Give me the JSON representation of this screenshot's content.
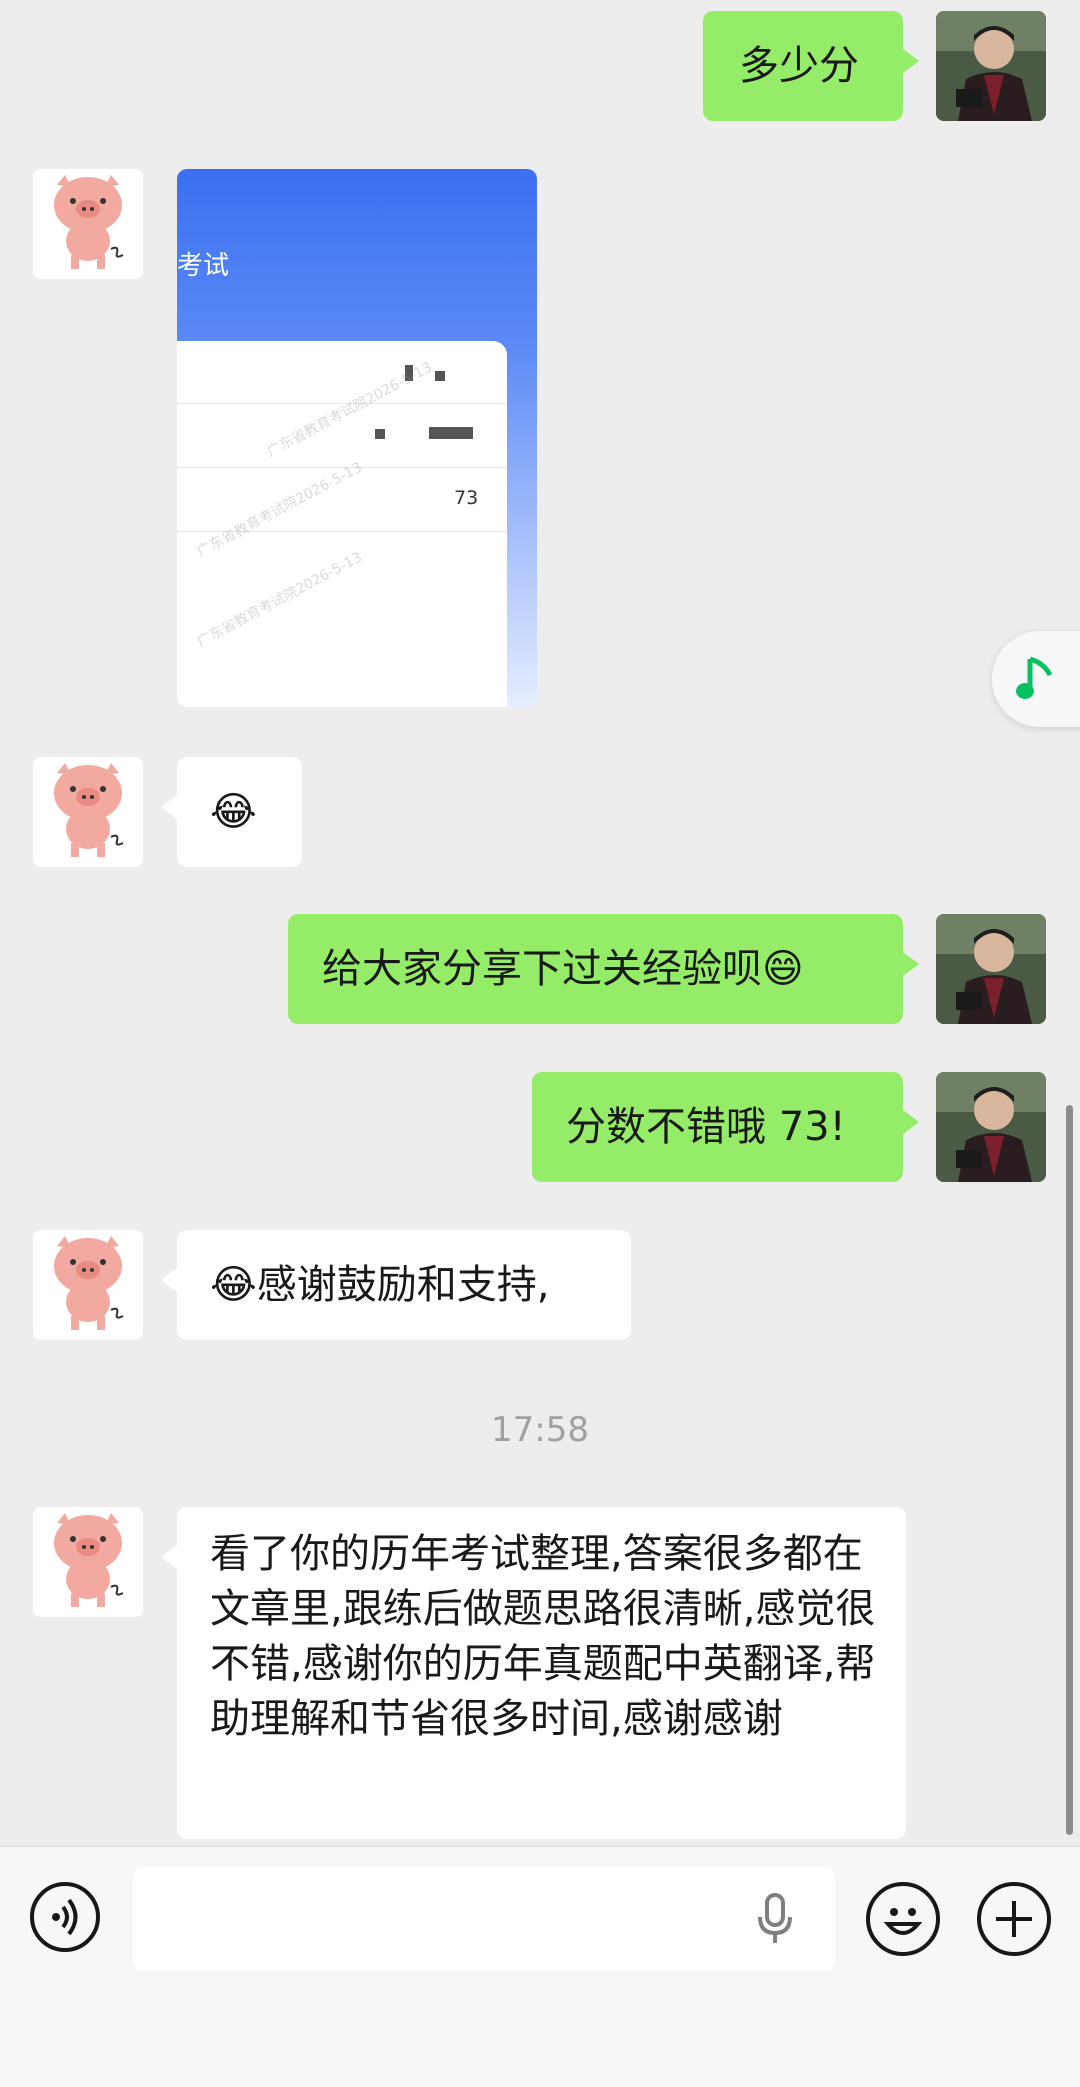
{
  "messages": {
    "m1": "多少分",
    "m2_card": {
      "title": "考试",
      "score": "73"
    },
    "m3_emoji": "😂",
    "m4": "给大家分享下过关经验呗😄",
    "m5": "分数不错哦 73!",
    "m6": "😂感谢鼓励和支持,",
    "time": "17:58",
    "m7": "看了你的历年考试整理,答案很多都在文章里,跟练后做题思路很清晰,感觉很不错,感谢你的历年真题配中英翻译,帮助理解和节省很多时间,感谢感谢"
  },
  "icons": {
    "voice": "voice-icon",
    "microphone": "microphone-icon",
    "emoji": "emoji-icon",
    "plus": "plus-icon",
    "music": "music-note-icon"
  },
  "colors": {
    "background": "#ededed",
    "sent_bubble": "#95ec69",
    "received_bubble": "#ffffff",
    "music_accent": "#07c160"
  }
}
